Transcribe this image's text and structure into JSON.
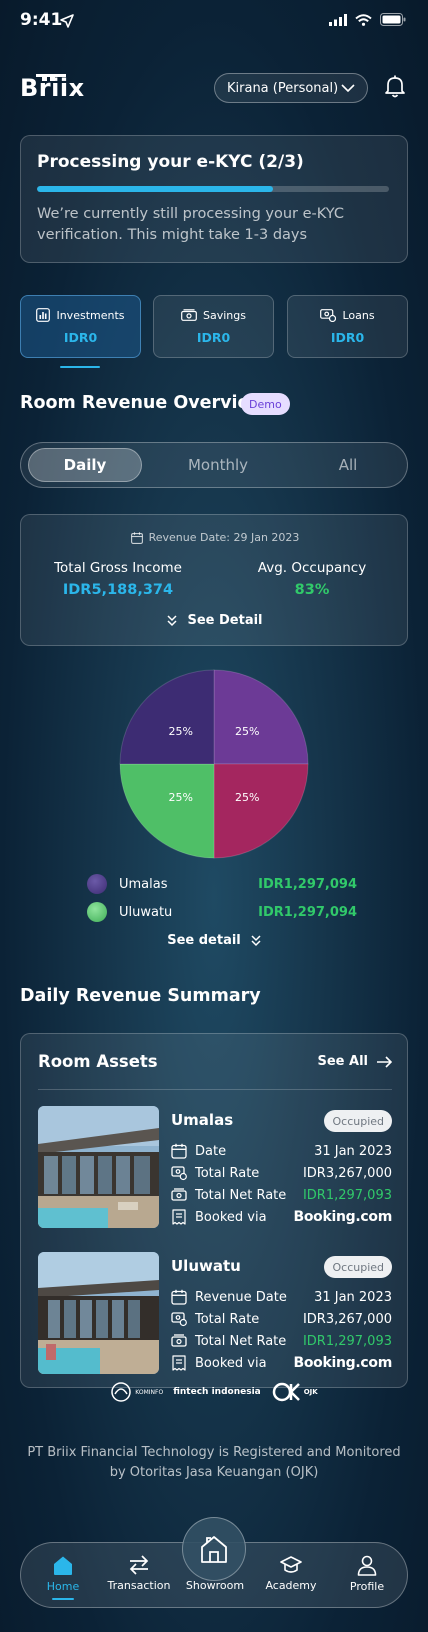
{
  "status_bar": {
    "time": "9:41"
  },
  "header": {
    "logo": "Briix",
    "account": "Kirana (Personal)"
  },
  "kyc": {
    "title": "Processing your e-KYC (2/3)",
    "progress": 0.67,
    "description": "We’re currently still processing your e-KYC verification. This might take 1-3 days"
  },
  "accounts": [
    {
      "label": "Investments",
      "value": "IDR0",
      "icon": "chart-icon"
    },
    {
      "label": "Savings",
      "value": "IDR0",
      "icon": "money-icon"
    },
    {
      "label": "Loans",
      "value": "IDR0",
      "icon": "loan-icon"
    }
  ],
  "overview": {
    "title": "Room Revenue Overview",
    "badge": "Demo",
    "tabs": [
      "Daily",
      "Monthly",
      "All"
    ],
    "revenue_date": "Revenue Date: 29 Jan 2023",
    "gross_income_label": "Total Gross Income",
    "gross_income_value": "IDR5,188,374",
    "occupancy_label": "Avg. Occupancy",
    "occupancy_value": "83%",
    "see_detail": "See Detail"
  },
  "chart_data": {
    "type": "pie",
    "values": [
      25,
      25,
      25,
      25
    ],
    "labels": [
      "25%",
      "25%",
      "25%",
      "25%"
    ],
    "colors": [
      "#6c3a96",
      "#a4265f",
      "#4fbf67",
      "#3d2c73"
    ]
  },
  "legend": [
    {
      "name": "Umalas",
      "value": "IDR1,297,094",
      "color": "#4a3a80"
    },
    {
      "name": "Uluwatu",
      "value": "IDR1,297,094",
      "color": "#5bc96e"
    }
  ],
  "pie_detail": "See detail",
  "summary": {
    "title": "Daily Revenue Summary",
    "card_title": "Room Assets",
    "see_all": "See All",
    "assets": [
      {
        "name": "Umalas",
        "status": "Occupied",
        "rows": [
          {
            "label": "Date",
            "value": "31 Jan 2023"
          },
          {
            "label": "Total Rate",
            "value": "IDR3,267,000"
          },
          {
            "label": "Total Net Rate",
            "value": "IDR1,297,093"
          },
          {
            "label": "Booked via",
            "value": "Booking.com"
          }
        ]
      },
      {
        "name": "Uluwatu",
        "status": "Occupied",
        "rows": [
          {
            "label": "Revenue Date",
            "value": "31 Jan 2023"
          },
          {
            "label": "Total Rate",
            "value": "IDR3,267,000"
          },
          {
            "label": "Total Net Rate",
            "value": "IDR1,297,093"
          },
          {
            "label": "Booked via",
            "value": "Booking.com"
          }
        ]
      }
    ]
  },
  "footer": {
    "logos": [
      "KOMINFO",
      "fintech indonesia",
      "OJK"
    ],
    "text": "PT Briix Financial Technology is Registered and Monitored by Otoritas Jasa Keuangan (OJK)"
  },
  "nav": [
    "Home",
    "Transaction",
    "Showroom",
    "Academy",
    "Profile"
  ],
  "colors": {
    "accent": "#2bb6ea",
    "positive": "#31c96a",
    "badge_bg": "#e6ddff",
    "badge_text": "#6a40d8"
  }
}
